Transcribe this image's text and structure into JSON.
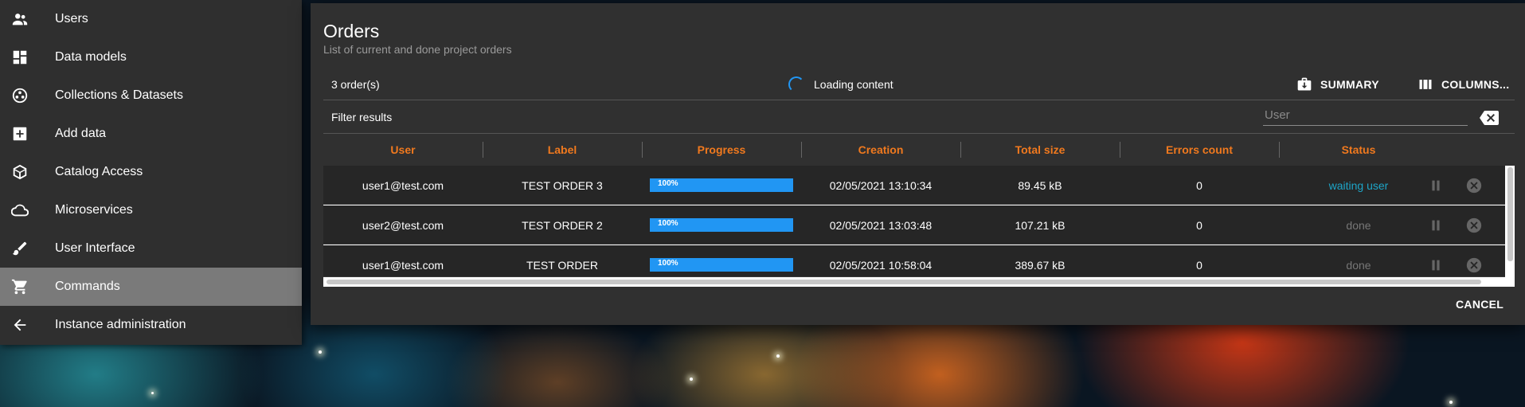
{
  "sidebar": {
    "items": [
      {
        "label": "Users",
        "icon": "users-icon"
      },
      {
        "label": "Data models",
        "icon": "dashboard-icon"
      },
      {
        "label": "Collections & Datasets",
        "icon": "bubbles-icon"
      },
      {
        "label": "Add data",
        "icon": "add-box-icon"
      },
      {
        "label": "Catalog Access",
        "icon": "cube-icon"
      },
      {
        "label": "Microservices",
        "icon": "cloud-icon"
      },
      {
        "label": "User Interface",
        "icon": "brush-icon"
      },
      {
        "label": "Commands",
        "icon": "cart-icon",
        "active": true
      },
      {
        "label": "Instance administration",
        "icon": "arrow-back-icon"
      }
    ]
  },
  "dialog": {
    "title": "Orders",
    "subtitle": "List of current and done project orders",
    "order_count": "3 order(s)",
    "loading_text": "Loading content",
    "summary_label": "SUMMARY",
    "columns_label": "COLUMNS...",
    "filter_label": "Filter results",
    "filter_placeholder": "User",
    "cancel_label": "CANCEL"
  },
  "table": {
    "headers": [
      "User",
      "Label",
      "Progress",
      "Creation",
      "Total size",
      "Errors count",
      "Status"
    ],
    "rows": [
      {
        "user": "user1@test.com",
        "label": "TEST ORDER 3",
        "progress": 100,
        "progress_text": "100%",
        "creation": "02/05/2021 13:10:34",
        "size": "89.45 kB",
        "errors": "0",
        "status": "waiting user",
        "status_kind": "waiting"
      },
      {
        "user": "user2@test.com",
        "label": "TEST ORDER 2",
        "progress": 100,
        "progress_text": "100%",
        "creation": "02/05/2021 13:03:48",
        "size": "107.21 kB",
        "errors": "0",
        "status": "done",
        "status_kind": "done"
      },
      {
        "user": "user1@test.com",
        "label": "TEST ORDER",
        "progress": 100,
        "progress_text": "100%",
        "creation": "02/05/2021 10:58:04",
        "size": "389.67 kB",
        "errors": "0",
        "status": "done",
        "status_kind": "done"
      }
    ]
  },
  "colors": {
    "accent_orange": "#f0791e",
    "progress_blue": "#2196f3",
    "status_waiting": "#1da5c8"
  }
}
